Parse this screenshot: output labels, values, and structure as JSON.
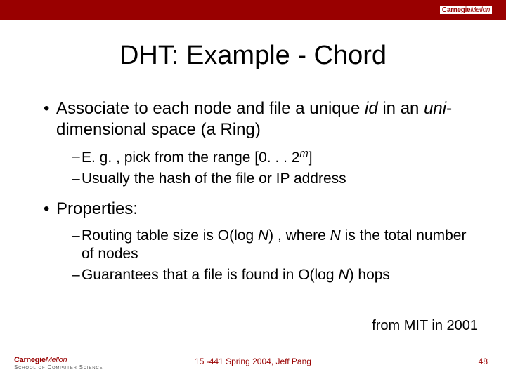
{
  "brand": {
    "top_wordmark_main": "Carnegie",
    "top_wordmark_sub": "Mellon",
    "footer_wordmark_main": "Carnegie",
    "footer_wordmark_sub": "Mellon",
    "footer_school": "School of Computer Science"
  },
  "title": "DHT: Example - Chord",
  "bullets": {
    "b1_pre": "Associate to each node and file a unique ",
    "b1_id": "id",
    "b1_mid": " in an ",
    "b1_uni": "uni",
    "b1_post": "-dimensional space (a Ring)",
    "b1_sub1_pre": "E. g. , pick from the range [0. . . 2",
    "b1_sub1_exp": "m",
    "b1_sub1_post": "]",
    "b1_sub2": "Usually the hash of the file or  IP address",
    "b2": "Properties:",
    "b2_sub1_pre": "Routing table size is O(log ",
    "b2_sub1_N1": "N",
    "b2_sub1_mid": ") , where ",
    "b2_sub1_N2": "N",
    "b2_sub1_post": " is the total number of nodes",
    "b2_sub2_pre": "Guarantees that a file is found in O(log ",
    "b2_sub2_N": "N",
    "b2_sub2_post": ") hops"
  },
  "attribution": "from MIT in 2001",
  "footer": {
    "center": "15 -441 Spring 2004, Jeff Pang",
    "page": "48"
  }
}
